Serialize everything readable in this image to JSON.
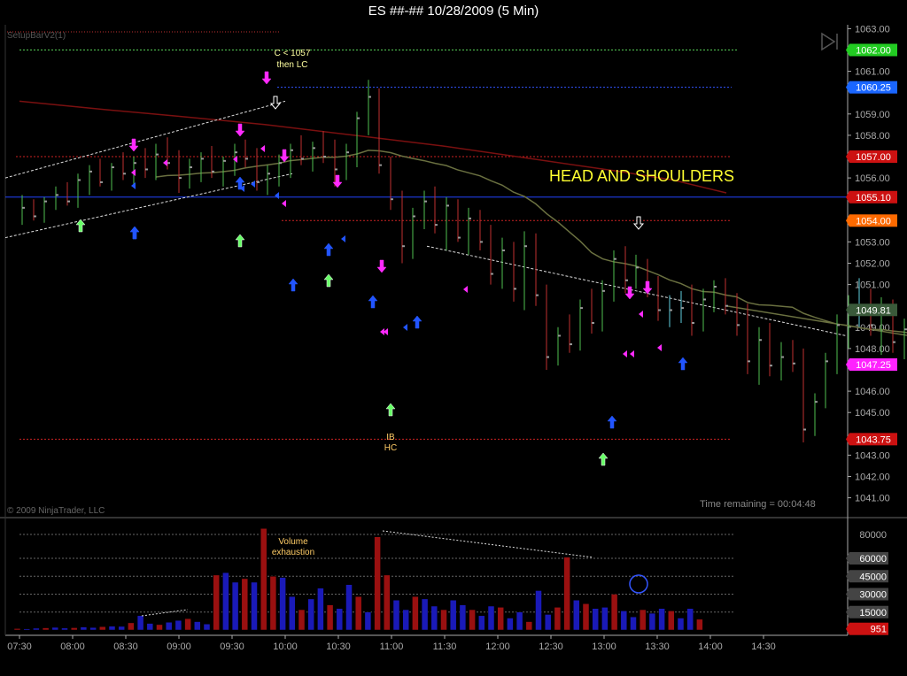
{
  "window": {
    "title": "ES ##-##  10/28/2009 (5 Min)"
  },
  "indicator_label": "SetupBarV2(1)",
  "copyright": "© 2009 NinjaTrader, LLC",
  "time_remaining": "Time remaining = 00:04:48",
  "annotations": {
    "head_shoulders": "HEAD AND SHOULDERS",
    "c1057": "C < 1057",
    "then_lc": "then LC",
    "ib": "IB",
    "hc": "HC",
    "volume_exhaustion_1": "Volume",
    "volume_exhaustion_2": "exhaustion"
  },
  "colors": {
    "up_bar": "#4fbf4f",
    "down_bar": "#c03030",
    "neutral_bar": "#5fd0e0",
    "vol_up": "#1a1ab8",
    "vol_down": "#9a1010",
    "arrow_magenta": "#ff2aff",
    "arrow_blue": "#2255ff",
    "arrow_green": "#66ff66",
    "ma_red": "#7a1010",
    "ma_olive": "#6a7040",
    "hline_blue": "#2244ff",
    "label_green": "#22cc22",
    "label_blue": "#1a66ff",
    "label_red": "#cc1111",
    "label_orange": "#ff6a00",
    "label_gray": "#3a5a3a",
    "label_magenta": "#ff22ff",
    "yellow_text": "#ffff30"
  },
  "chart_data": [
    {
      "type": "line",
      "title": "ES ##-##  10/28/2009 (5 Min)",
      "ylim": [
        1040,
        1063.5
      ],
      "yticks": [
        "1063.00",
        "1061.00",
        "1059.00",
        "1058.00",
        "1056.00",
        "1053.00",
        "1052.00",
        "1051.00",
        "1049.00",
        "1048.00",
        "1046.00",
        "1045.00",
        "1043.00",
        "1042.00",
        "1041.00"
      ],
      "ytick_values": [
        1063,
        1061,
        1059,
        1058,
        1056,
        1053,
        1052,
        1051,
        1049,
        1048,
        1046,
        1045,
        1043,
        1042,
        1041
      ],
      "xticks": [
        "07:30",
        "08:00",
        "08:30",
        "09:00",
        "09:30",
        "10:00",
        "10:30",
        "11:00",
        "11:30",
        "12:00",
        "12:30",
        "13:00",
        "13:30",
        "14:00",
        "14:30"
      ],
      "price_labels": [
        {
          "text": "1062.00",
          "value": 1062.0,
          "color": "#22cc22"
        },
        {
          "text": "1060.25",
          "value": 1060.25,
          "color": "#1a66ff"
        },
        {
          "text": "1057.00",
          "value": 1057.0,
          "color": "#cc1111"
        },
        {
          "text": "1055.10",
          "value": 1055.1,
          "color": "#cc1111"
        },
        {
          "text": "1054.00",
          "value": 1054.0,
          "color": "#ff6a00"
        },
        {
          "text": "1049.81",
          "value": 1049.81,
          "color": "#3a5a3a"
        },
        {
          "text": "1047.25",
          "value": 1047.25,
          "color": "#ff22ff"
        },
        {
          "text": "1043.75",
          "value": 1043.75,
          "color": "#cc1111"
        }
      ],
      "levels": [
        {
          "value": 1062.0,
          "style": "green-dotted"
        },
        {
          "value": 1060.25,
          "style": "blue-dotted"
        },
        {
          "value": 1057.0,
          "style": "red-dotted"
        },
        {
          "value": 1055.1,
          "style": "blue-solid"
        },
        {
          "value": 1054.0,
          "style": "red-dotted"
        },
        {
          "value": 1043.75,
          "style": "red-dotted"
        }
      ],
      "bars": [
        [
          1054.3,
          1055.2,
          1053.8,
          1054.6
        ],
        [
          1054.6,
          1055.0,
          1054.0,
          1054.2
        ],
        [
          1054.2,
          1055.1,
          1053.9,
          1054.9
        ],
        [
          1054.9,
          1055.6,
          1054.5,
          1055.2
        ],
        [
          1055.2,
          1055.8,
          1054.7,
          1054.9
        ],
        [
          1054.9,
          1056.2,
          1054.6,
          1055.9
        ],
        [
          1055.9,
          1056.6,
          1055.2,
          1056.3
        ],
        [
          1056.3,
          1056.9,
          1055.6,
          1055.8
        ],
        [
          1055.8,
          1056.7,
          1055.4,
          1056.5
        ],
        [
          1056.5,
          1057.2,
          1055.9,
          1056.2
        ],
        [
          1056.2,
          1057.0,
          1055.7,
          1056.7
        ],
        [
          1056.7,
          1057.4,
          1056.0,
          1056.4
        ],
        [
          1056.4,
          1057.6,
          1055.9,
          1057.1
        ],
        [
          1057.1,
          1057.9,
          1056.4,
          1056.7
        ],
        [
          1056.7,
          1057.3,
          1055.3,
          1056.0
        ],
        [
          1056.0,
          1056.9,
          1055.5,
          1056.5
        ],
        [
          1056.5,
          1057.2,
          1055.8,
          1056.9
        ],
        [
          1056.9,
          1057.5,
          1056.0,
          1056.3
        ],
        [
          1056.3,
          1057.0,
          1055.6,
          1056.8
        ],
        [
          1056.8,
          1057.6,
          1056.1,
          1057.2
        ],
        [
          1057.2,
          1057.8,
          1056.5,
          1056.9
        ],
        [
          1056.9,
          1057.4,
          1055.4,
          1055.8
        ],
        [
          1055.8,
          1056.6,
          1055.2,
          1056.2
        ],
        [
          1056.2,
          1057.1,
          1055.6,
          1056.7
        ],
        [
          1056.7,
          1057.6,
          1056.0,
          1057.3
        ],
        [
          1057.3,
          1058.0,
          1056.6,
          1056.9
        ],
        [
          1056.9,
          1057.7,
          1056.3,
          1057.4
        ],
        [
          1057.4,
          1058.2,
          1056.7,
          1057.0
        ],
        [
          1057.0,
          1057.8,
          1055.6,
          1056.4
        ],
        [
          1056.4,
          1057.6,
          1055.9,
          1057.2
        ],
        [
          1057.2,
          1059.1,
          1056.5,
          1058.8
        ],
        [
          1058.8,
          1060.6,
          1058.0,
          1059.8
        ],
        [
          1059.8,
          1060.2,
          1056.2,
          1056.6
        ],
        [
          1056.6,
          1057.0,
          1054.5,
          1055.0
        ],
        [
          1055.0,
          1055.4,
          1052.0,
          1052.8
        ],
        [
          1052.8,
          1054.6,
          1052.2,
          1054.2
        ],
        [
          1054.2,
          1055.4,
          1053.6,
          1054.9
        ],
        [
          1054.9,
          1055.6,
          1053.4,
          1053.8
        ],
        [
          1053.8,
          1055.1,
          1052.6,
          1054.7
        ],
        [
          1054.7,
          1055.0,
          1053.0,
          1053.2
        ],
        [
          1053.2,
          1054.6,
          1052.4,
          1054.1
        ],
        [
          1054.1,
          1054.5,
          1052.6,
          1053.0
        ],
        [
          1053.0,
          1053.8,
          1051.0,
          1051.5
        ],
        [
          1051.5,
          1053.2,
          1050.8,
          1052.6
        ],
        [
          1052.6,
          1053.0,
          1050.2,
          1050.8
        ],
        [
          1050.8,
          1053.5,
          1049.8,
          1052.8
        ],
        [
          1052.8,
          1053.4,
          1050.0,
          1050.5
        ],
        [
          1050.5,
          1051.0,
          1047.0,
          1047.6
        ],
        [
          1047.6,
          1049.0,
          1047.2,
          1048.6
        ],
        [
          1048.6,
          1049.6,
          1047.8,
          1048.2
        ],
        [
          1048.2,
          1050.3,
          1047.9,
          1049.9
        ],
        [
          1049.9,
          1050.8,
          1048.7,
          1049.2
        ],
        [
          1049.2,
          1051.2,
          1048.8,
          1050.7
        ],
        [
          1050.7,
          1052.6,
          1050.2,
          1052.2
        ],
        [
          1052.2,
          1052.8,
          1050.6,
          1051.2
        ],
        [
          1051.2,
          1052.4,
          1050.8,
          1051.8
        ],
        [
          1051.8,
          1052.2,
          1050.4,
          1050.8
        ],
        [
          1050.8,
          1051.4,
          1049.3,
          1049.8
        ],
        [
          1049.8,
          1050.5,
          1049.0,
          1049.8
        ],
        [
          1049.8,
          1050.7,
          1049.2,
          1049.9
        ],
        [
          1049.9,
          1051.0,
          1048.6,
          1049.2
        ],
        [
          1049.2,
          1050.8,
          1048.8,
          1050.3
        ],
        [
          1050.3,
          1051.2,
          1049.7,
          1050.9
        ],
        [
          1050.9,
          1051.3,
          1049.6,
          1050.0
        ],
        [
          1050.0,
          1050.6,
          1048.6,
          1049.1
        ],
        [
          1049.1,
          1050.1,
          1046.8,
          1047.4
        ],
        [
          1047.4,
          1049.0,
          1046.3,
          1048.4
        ],
        [
          1048.4,
          1049.2,
          1046.7,
          1047.2
        ],
        [
          1047.2,
          1048.3,
          1046.5,
          1047.6
        ],
        [
          1047.6,
          1048.4,
          1046.9,
          1047.3
        ],
        [
          1047.3,
          1048.0,
          1043.6,
          1044.2
        ],
        [
          1044.2,
          1045.9,
          1043.9,
          1045.5
        ],
        [
          1045.5,
          1047.8,
          1045.2,
          1047.4
        ],
        [
          1047.4,
          1049.6,
          1046.8,
          1049.1
        ],
        [
          1049.1,
          1050.5,
          1048.0,
          1049.9
        ],
        [
          1049.9,
          1051.3,
          1049.0,
          1049.8
        ],
        [
          1049.8,
          1050.8,
          1048.6,
          1049.1
        ],
        [
          1049.1,
          1050.4,
          1047.7,
          1049.8
        ],
        [
          1049.8,
          1050.3,
          1047.8,
          1048.3
        ],
        [
          1048.3,
          1049.4,
          1047.5,
          1048.9
        ],
        [
          1048.9,
          1049.3,
          1047.2,
          1047.7
        ],
        [
          1047.7,
          1049.1,
          1047.3,
          1048.6
        ],
        [
          1048.6,
          1048.9,
          1047.0,
          1047.3
        ],
        [
          1047.3,
          1047.8,
          1046.2,
          1047.5
        ],
        [
          1047.5,
          1047.9,
          1046.9,
          1047.3
        ]
      ],
      "up_arrows_blue": [
        12,
        30,
        46,
        53,
        65,
        79,
        98,
        120,
        134,
        174,
        205,
        250
      ],
      "up_arrows_green": [
        4,
        27,
        45,
        77,
        134
      ],
      "down_arrows_magenta": [
        13,
        27,
        29,
        32,
        40,
        48,
        58,
        82,
        88,
        97
      ],
      "down_arrows_red": [
        30,
        84
      ]
    },
    {
      "type": "bar",
      "title": "Volume",
      "ylim": [
        0,
        85000
      ],
      "yticks": [
        "80000",
        "60000",
        "45000",
        "30000",
        "15000",
        "951"
      ],
      "ytick_values": [
        80000,
        60000,
        45000,
        30000,
        15000,
        951
      ],
      "values": [
        1200,
        1000,
        1500,
        1800,
        2200,
        1600,
        1900,
        2500,
        2100,
        2800,
        3200,
        3000,
        6000,
        12000,
        5500,
        4500,
        6500,
        8000,
        9500,
        7000,
        5000,
        46000,
        48000,
        40000,
        43000,
        40000,
        85000,
        45000,
        44000,
        28000,
        17000,
        26000,
        35000,
        21000,
        18000,
        38000,
        28000,
        15000,
        78000,
        46000,
        25000,
        17000,
        28000,
        26000,
        20000,
        17000,
        25000,
        21000,
        17000,
        12000,
        20000,
        19000,
        10000,
        15000,
        7000,
        33000,
        13000,
        19000,
        61000,
        25000,
        22000,
        18000,
        19000,
        30000,
        16000,
        11000,
        17000,
        14000,
        18000,
        16000,
        10000,
        18000,
        9000
      ],
      "colors": "up/down alternating per price bar"
    }
  ]
}
